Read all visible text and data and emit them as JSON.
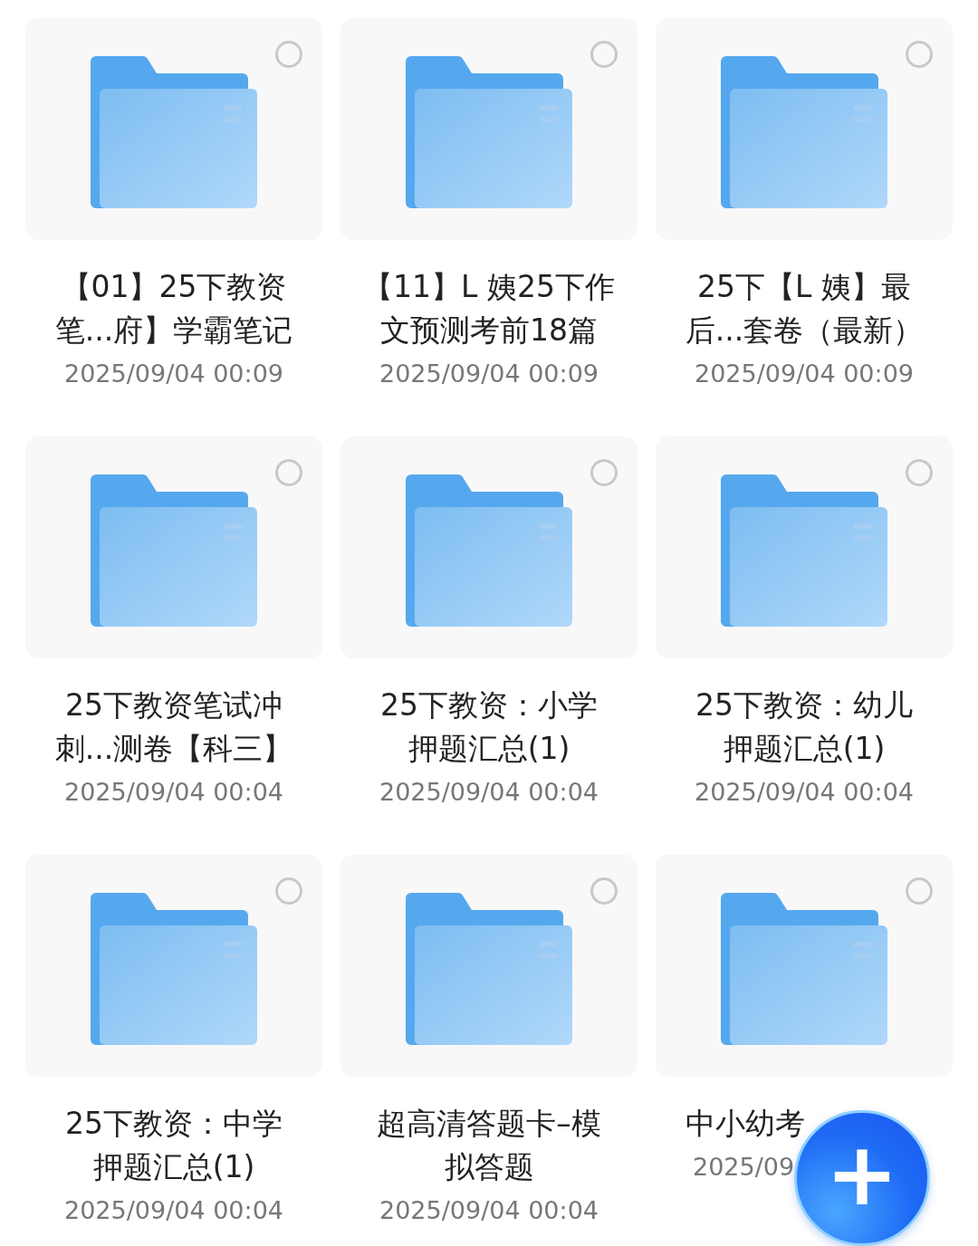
{
  "folders": [
    {
      "title_lines": [
        "【01】25下教资",
        "笔...府】学霸笔记"
      ],
      "date": "2025/09/04 00:09",
      "selected": false
    },
    {
      "title_lines": [
        "【11】L 姨25下作",
        "文预测考前18篇"
      ],
      "date": "2025/09/04 00:09",
      "selected": false
    },
    {
      "title_lines": [
        "25下【L 姨】最",
        "后...套卷（最新）"
      ],
      "date": "2025/09/04 00:09",
      "selected": false
    },
    {
      "title_lines": [
        "25下教资笔试冲",
        "刺...测卷【科三】"
      ],
      "date": "2025/09/04 00:04",
      "selected": false
    },
    {
      "title_lines": [
        "25下教资：小学",
        "押题汇总(1)"
      ],
      "date": "2025/09/04 00:04",
      "selected": false
    },
    {
      "title_lines": [
        "25下教资：幼儿",
        "押题汇总(1)"
      ],
      "date": "2025/09/04 00:04",
      "selected": false
    },
    {
      "title_lines": [
        "25下教资：中学",
        "押题汇总(1)"
      ],
      "date": "2025/09/04 00:04",
      "selected": false
    },
    {
      "title_lines": [
        "超高清答题卡–模",
        "拟答题"
      ],
      "date": "2025/09/04 00:04",
      "selected": false
    },
    {
      "title_lines": [
        "中小幼考"
      ],
      "date": "2025/09",
      "selected": false,
      "covered": true
    }
  ],
  "add_button": {
    "label": "+"
  }
}
